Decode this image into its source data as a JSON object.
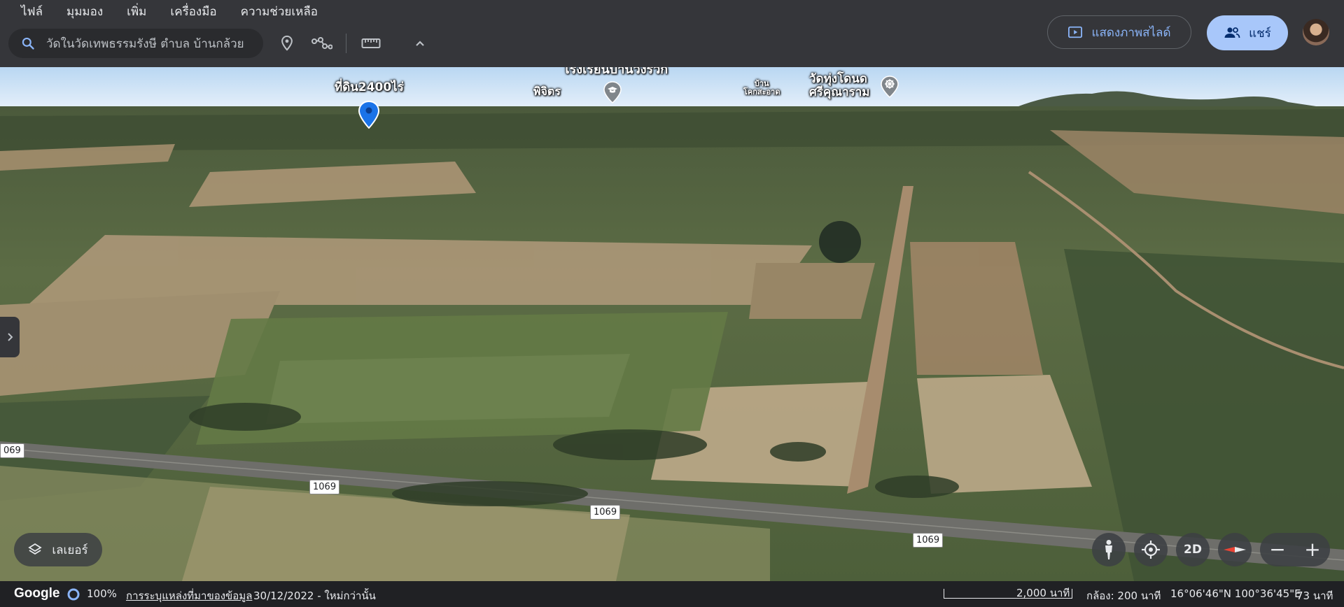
{
  "menu": [
    "ไฟล์",
    "มุมมอง",
    "เพิ่ม",
    "เครื่องมือ",
    "ความช่วยเหลือ"
  ],
  "search": {
    "value": "วัดในวัดเทพธรรมรังษี ตำบล บ้านกล้วย"
  },
  "toolbar": {
    "icons": [
      "search-icon",
      "placemark-icon",
      "path-icon",
      "ruler-icon",
      "chevron-up-icon"
    ]
  },
  "actions": {
    "slideshow_label": "แสดงภาพสไลด์",
    "share_label": "แชร์"
  },
  "map_labels": {
    "placemark": "ที่ดิน2400ไร่",
    "school": "โรงเรียนบ้านวังรวก",
    "school_sub": "พิจิตร",
    "village_line1": "บ้าน",
    "village_line2": "โคกสะอาด",
    "temple_line1": "วัดทุ่งโดนด",
    "temple_line2": "ศรีคุณาราม"
  },
  "road_shields": [
    "069",
    "1069",
    "1069",
    "1069"
  ],
  "controls": {
    "layers_label": "เลเยอร์",
    "mode_2d": "2D",
    "zoom_out": "−",
    "zoom_in": "+"
  },
  "status": {
    "brand": "Google",
    "load_percent": "100%",
    "data_sources": "การระบุแหล่งที่มาของข้อมูล",
    "imagery_date": "30/12/2022 - ใหม่กว่านั้น",
    "scale": "2,000 นาที",
    "camera": "กล้อง: 200 นาที",
    "coords": "16°06'46\"N 100°36'45\"E",
    "elevation": "73 นาที"
  },
  "colors": {
    "accent": "#8ab4f8",
    "share_bg": "#a8c7fa",
    "placemark": "#1a73e8"
  }
}
